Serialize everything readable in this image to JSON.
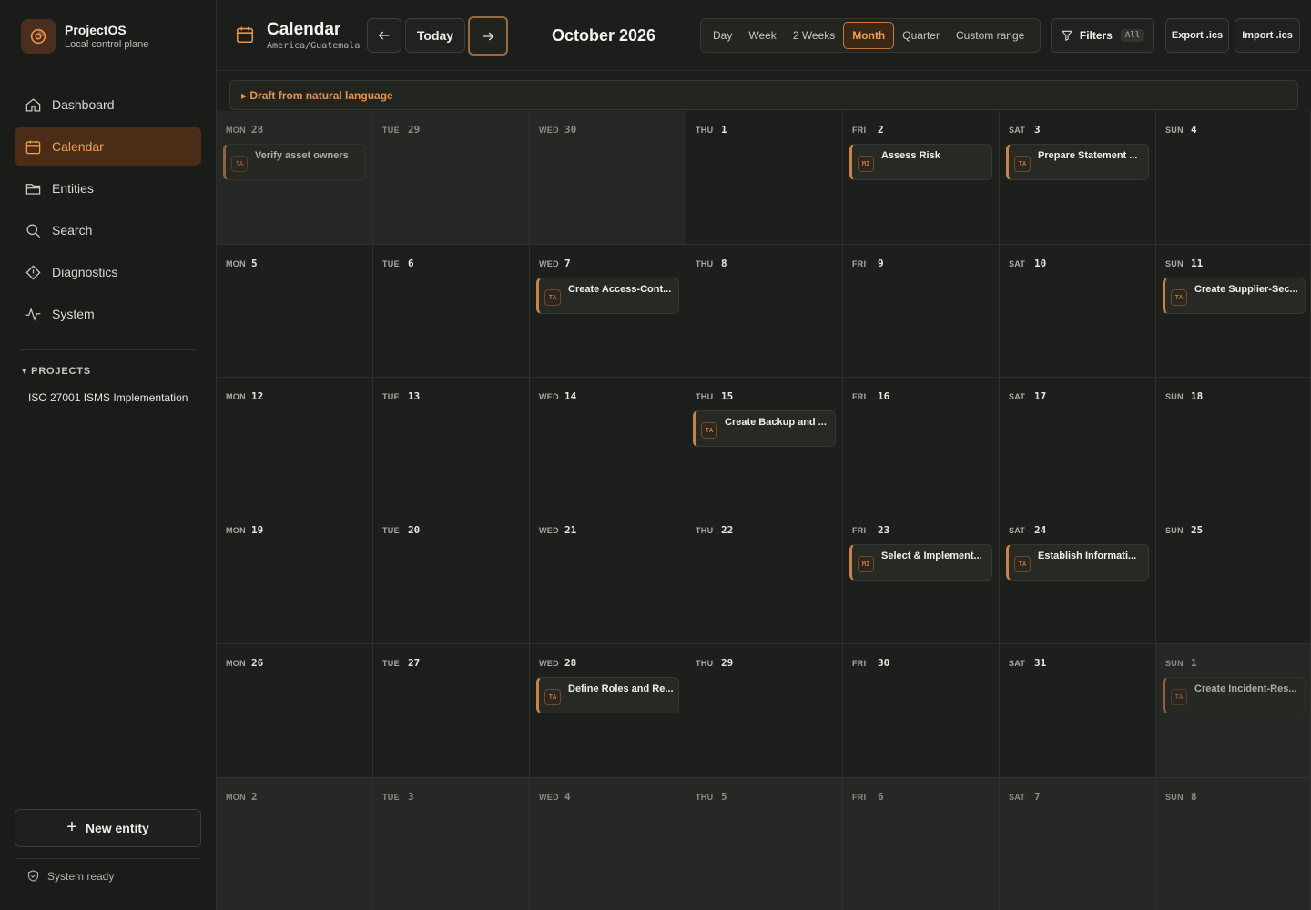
{
  "brand": {
    "name": "ProjectOS",
    "subtitle": "Local control plane"
  },
  "nav": [
    {
      "label": "Dashboard",
      "icon": "home-icon",
      "active": false
    },
    {
      "label": "Calendar",
      "icon": "calendar-icon",
      "active": true
    },
    {
      "label": "Entities",
      "icon": "folder-icon",
      "active": false
    },
    {
      "label": "Search",
      "icon": "search-icon",
      "active": false
    },
    {
      "label": "Diagnostics",
      "icon": "diamond-icon",
      "active": false
    },
    {
      "label": "System",
      "icon": "activity-icon",
      "active": false
    }
  ],
  "projects": {
    "heading": "▾ PROJECTS",
    "items": [
      "ISO 27001 ISMS Implementation"
    ]
  },
  "new_entity_label": "New entity",
  "status": "System ready",
  "header": {
    "title": "Calendar",
    "timezone": "America/Guatemala",
    "today_label": "Today",
    "month_label": "October 2026",
    "views": [
      "Day",
      "Week",
      "2 Weeks",
      "Month",
      "Quarter",
      "Custom range"
    ],
    "active_view": "Month",
    "filters_label": "Filters",
    "filters_value": "All",
    "export_label": "Export .ics",
    "import_label": "Import .ics"
  },
  "draft_label": "▸ Draft from natural language",
  "accent_color": "#e9924a",
  "weeks": [
    [
      {
        "dow": "MON",
        "day": "28",
        "out": true,
        "events": [
          {
            "badge": "TA",
            "title": "Verify asset owners"
          }
        ]
      },
      {
        "dow": "TUE",
        "day": "29",
        "out": true,
        "events": []
      },
      {
        "dow": "WED",
        "day": "30",
        "out": true,
        "events": []
      },
      {
        "dow": "THU",
        "day": "1",
        "out": false,
        "events": []
      },
      {
        "dow": "FRI",
        "day": "2",
        "out": false,
        "events": [
          {
            "badge": "MI",
            "title": "Assess Risk"
          }
        ]
      },
      {
        "dow": "SAT",
        "day": "3",
        "out": false,
        "events": [
          {
            "badge": "TA",
            "title": "Prepare Statement ..."
          }
        ]
      },
      {
        "dow": "SUN",
        "day": "4",
        "out": false,
        "events": []
      }
    ],
    [
      {
        "dow": "MON",
        "day": "5",
        "out": false,
        "events": []
      },
      {
        "dow": "TUE",
        "day": "6",
        "out": false,
        "events": []
      },
      {
        "dow": "WED",
        "day": "7",
        "out": false,
        "events": [
          {
            "badge": "TA",
            "title": "Create Access-Cont..."
          }
        ]
      },
      {
        "dow": "THU",
        "day": "8",
        "out": false,
        "events": []
      },
      {
        "dow": "FRI",
        "day": "9",
        "out": false,
        "events": []
      },
      {
        "dow": "SAT",
        "day": "10",
        "out": false,
        "events": []
      },
      {
        "dow": "SUN",
        "day": "11",
        "out": false,
        "events": [
          {
            "badge": "TA",
            "title": "Create Supplier-Sec..."
          }
        ]
      }
    ],
    [
      {
        "dow": "MON",
        "day": "12",
        "out": false,
        "events": []
      },
      {
        "dow": "TUE",
        "day": "13",
        "out": false,
        "events": []
      },
      {
        "dow": "WED",
        "day": "14",
        "out": false,
        "events": []
      },
      {
        "dow": "THU",
        "day": "15",
        "out": false,
        "events": [
          {
            "badge": "TA",
            "title": "Create Backup and ..."
          }
        ]
      },
      {
        "dow": "FRI",
        "day": "16",
        "out": false,
        "events": []
      },
      {
        "dow": "SAT",
        "day": "17",
        "out": false,
        "events": []
      },
      {
        "dow": "SUN",
        "day": "18",
        "out": false,
        "events": []
      }
    ],
    [
      {
        "dow": "MON",
        "day": "19",
        "out": false,
        "events": []
      },
      {
        "dow": "TUE",
        "day": "20",
        "out": false,
        "events": []
      },
      {
        "dow": "WED",
        "day": "21",
        "out": false,
        "events": []
      },
      {
        "dow": "THU",
        "day": "22",
        "out": false,
        "events": []
      },
      {
        "dow": "FRI",
        "day": "23",
        "out": false,
        "events": [
          {
            "badge": "MI",
            "title": "Select & Implement..."
          }
        ]
      },
      {
        "dow": "SAT",
        "day": "24",
        "out": false,
        "events": [
          {
            "badge": "TA",
            "title": "Establish Informati..."
          }
        ]
      },
      {
        "dow": "SUN",
        "day": "25",
        "out": false,
        "events": []
      }
    ],
    [
      {
        "dow": "MON",
        "day": "26",
        "out": false,
        "events": []
      },
      {
        "dow": "TUE",
        "day": "27",
        "out": false,
        "events": []
      },
      {
        "dow": "WED",
        "day": "28",
        "out": false,
        "events": [
          {
            "badge": "TA",
            "title": "Define Roles and Re..."
          }
        ]
      },
      {
        "dow": "THU",
        "day": "29",
        "out": false,
        "events": []
      },
      {
        "dow": "FRI",
        "day": "30",
        "out": false,
        "events": []
      },
      {
        "dow": "SAT",
        "day": "31",
        "out": false,
        "events": []
      },
      {
        "dow": "SUN",
        "day": "1",
        "out": true,
        "events": [
          {
            "badge": "TA",
            "title": "Create Incident-Res..."
          }
        ]
      }
    ],
    [
      {
        "dow": "MON",
        "day": "2",
        "out": true,
        "events": []
      },
      {
        "dow": "TUE",
        "day": "3",
        "out": true,
        "events": []
      },
      {
        "dow": "WED",
        "day": "4",
        "out": true,
        "events": []
      },
      {
        "dow": "THU",
        "day": "5",
        "out": true,
        "events": []
      },
      {
        "dow": "FRI",
        "day": "6",
        "out": true,
        "events": []
      },
      {
        "dow": "SAT",
        "day": "7",
        "out": true,
        "events": []
      },
      {
        "dow": "SUN",
        "day": "8",
        "out": true,
        "events": []
      }
    ]
  ]
}
